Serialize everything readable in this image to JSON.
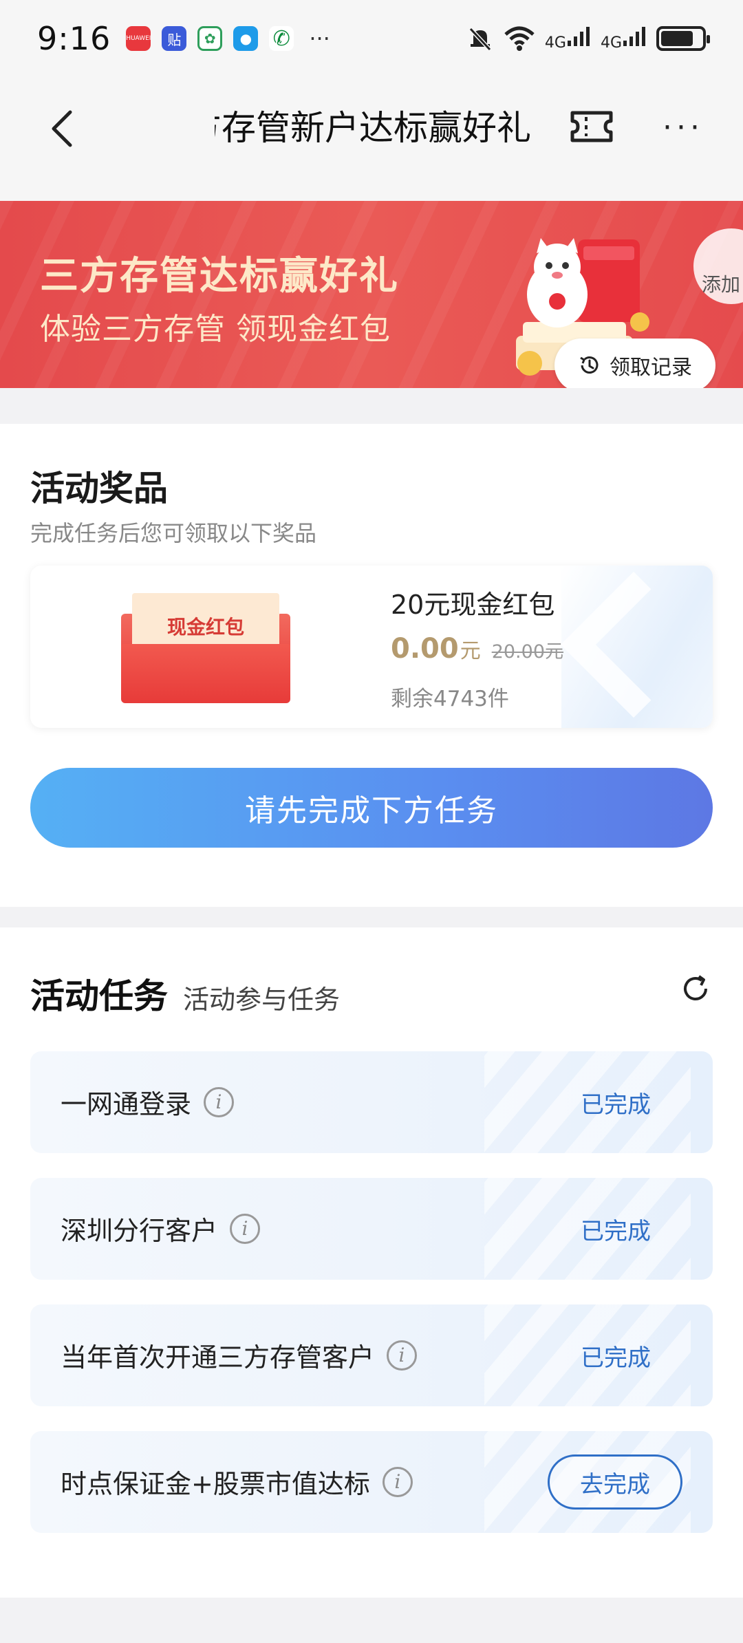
{
  "status_bar": {
    "time": "9:16",
    "more": "···",
    "signal_1": "4G",
    "signal_2": "4G",
    "app_huawei": "HUAWEI",
    "app_tieba": "贴"
  },
  "header": {
    "title": "三方存管新户达标赢好礼",
    "more": "···"
  },
  "banner": {
    "title": "三方存管达标赢好礼",
    "subtitle": "体验三方存管 领现金红包",
    "add_chip": "添加",
    "record_button": "领取记录"
  },
  "prize_section": {
    "title": "活动奖品",
    "subtitle": "完成任务后您可领取以下奖品",
    "prize": {
      "envelope_text": "现金红包",
      "name": "20元现金红包",
      "price": "0.00",
      "price_unit": "元",
      "original_price": "20.00元",
      "stock": "剩余4743件"
    },
    "main_button": "请先完成下方任务"
  },
  "task_section": {
    "title": "活动任务",
    "subtitle": "活动参与任务",
    "tasks": [
      {
        "label": "一网通登录",
        "status": "已完成"
      },
      {
        "label": "深圳分行客户",
        "status": "已完成"
      },
      {
        "label": "当年首次开通三方存管客户",
        "status": "已完成"
      },
      {
        "label": "时点保证金+股票市值达标",
        "status": "去完成"
      }
    ]
  },
  "colors": {
    "banner_red": "#e44a4c",
    "gold_price": "#b49a6e",
    "task_blue": "#2f6fc7",
    "button_blue_start": "#55b0f4",
    "button_blue_end": "#5d78e4"
  }
}
